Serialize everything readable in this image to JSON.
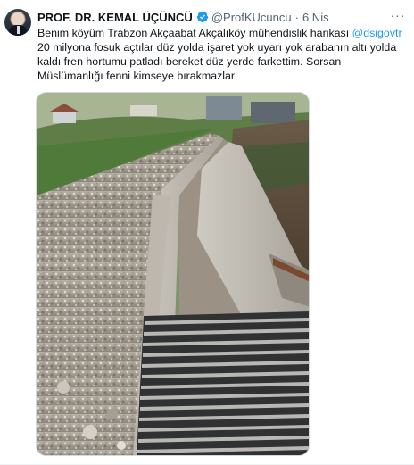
{
  "tweet": {
    "author_name": "PROF. DR. KEMAL ÜÇÜNCÜ",
    "handle": "@ProfKUcuncu",
    "separator": "·",
    "date": "6 Nis",
    "more_label": "···",
    "text_part1": "Benim köyüm Trabzon Akçaabat Akçalıköy mühendislik harikası ",
    "mention": "@dsigovtr",
    "text_part2": " 20 milyona fosuk açtılar düz yolda işaret yok uyarı yok arabanın altı yolda kaldı fren hortumu patladı bereket düz yerde farkettim. Sorsan Müslümanlığı fenni kimseye bırakmazlar"
  },
  "colors": {
    "verified_badge": "#1d9bf0",
    "mention": "#1d9bf0",
    "secondary_text": "#536471"
  },
  "icons": {
    "verified": "verified-badge-icon",
    "more": "more-options-icon"
  }
}
